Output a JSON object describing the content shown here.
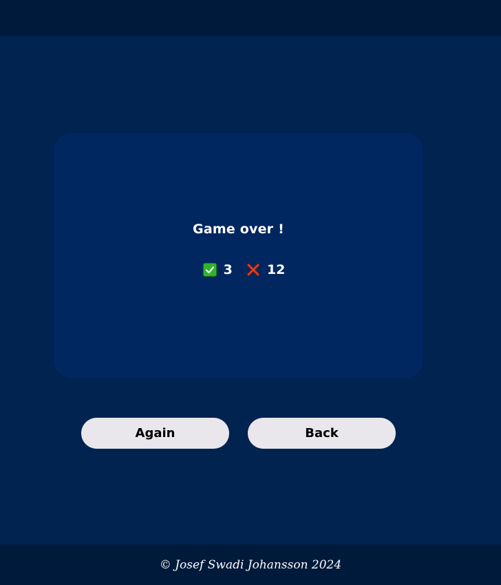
{
  "result": {
    "title": "Game over !",
    "correct_count": "3",
    "wrong_count": "12",
    "correct_icon": "check-icon",
    "wrong_icon": "cross-icon"
  },
  "buttons": {
    "again_label": "Again",
    "back_label": "Back"
  },
  "footer": {
    "text": "© Josef Swadi Johansson 2024"
  },
  "colors": {
    "background": "#00234f",
    "bars": "#001a3b",
    "card": "#002760",
    "button": "#e9e7ec",
    "correct": "#2fb52c",
    "wrong": "#e0401c"
  }
}
